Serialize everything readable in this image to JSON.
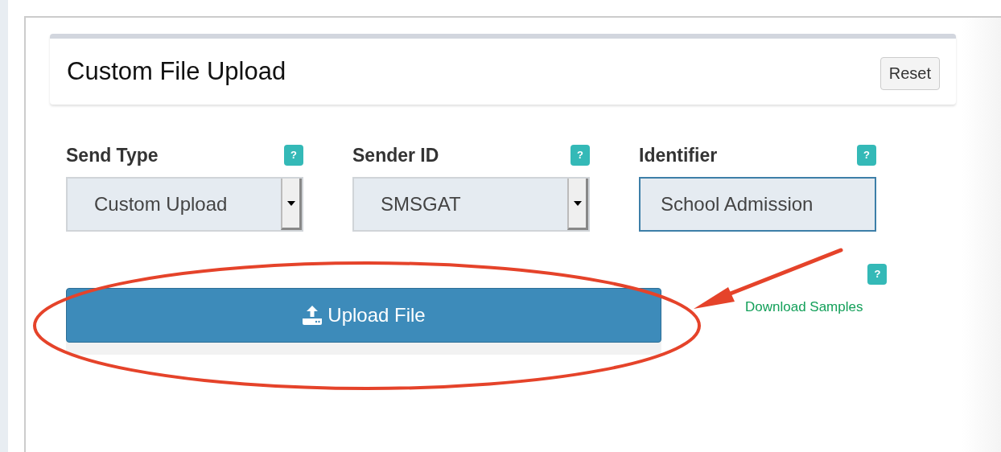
{
  "card": {
    "title": "Custom File Upload",
    "reset_button": "Reset"
  },
  "fields": [
    {
      "kind": "select",
      "label": "Send Type",
      "help": "?",
      "value": "Custom Upload"
    },
    {
      "kind": "select",
      "label": "Sender ID",
      "help": "?",
      "value": "SMSGAT"
    },
    {
      "kind": "text",
      "label": "Identifier",
      "help": "?",
      "value": "School Admission"
    }
  ],
  "upload_button": "Upload File",
  "samples": {
    "help": "?",
    "link": "Download Samples"
  }
}
